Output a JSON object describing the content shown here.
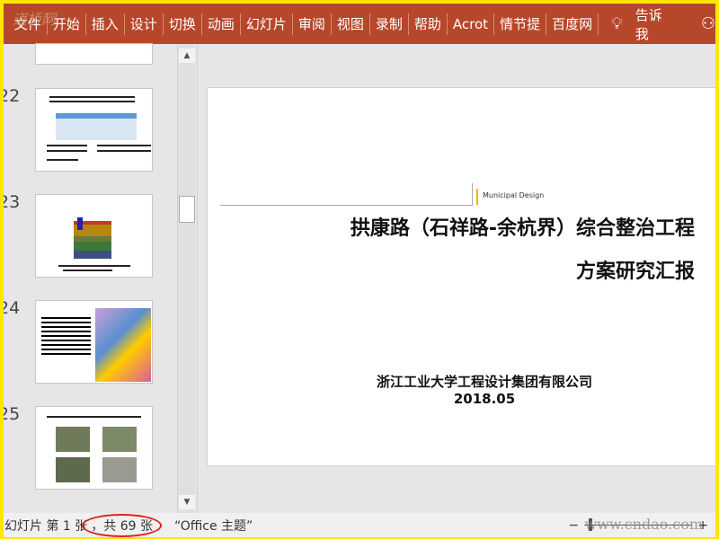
{
  "ribbon": {
    "tabs": [
      "文件",
      "开始",
      "插入",
      "设计",
      "切换",
      "动画",
      "幻灯片",
      "审阅",
      "视图",
      "录制",
      "帮助",
      "Acrot",
      "情节提",
      "百度网"
    ],
    "tell_me": "告诉我",
    "watermark": "道桥网"
  },
  "thumbnails": [
    {
      "number": "22"
    },
    {
      "number": "23"
    },
    {
      "number": "24"
    },
    {
      "number": "25"
    }
  ],
  "slide": {
    "tag": "Municipal Design",
    "title": "拱康路（石祥路-余杭界）综合整治工程",
    "subtitle": "方案研究汇报",
    "company": "浙江工业大学工程设计集团有限公司",
    "date": "2018.05"
  },
  "status": {
    "slide_info": "幻灯片 第 1 张",
    "total": "，共 69 张",
    "theme": "“Office 主题”",
    "watermark": "www.cndao.com"
  },
  "colors": {
    "ribbon": "#b7472a",
    "accent": "#f0b400",
    "border": "#ffe600",
    "annotation": "#e02020"
  }
}
